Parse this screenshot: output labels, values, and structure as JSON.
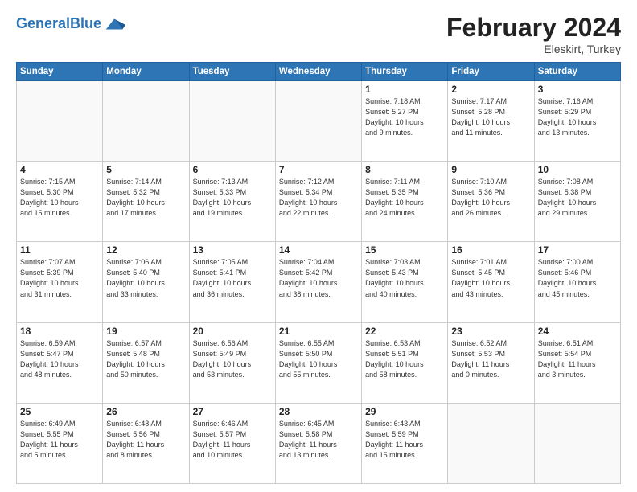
{
  "header": {
    "logo_general": "General",
    "logo_blue": "Blue",
    "month": "February 2024",
    "location": "Eleskirt, Turkey"
  },
  "weekdays": [
    "Sunday",
    "Monday",
    "Tuesday",
    "Wednesday",
    "Thursday",
    "Friday",
    "Saturday"
  ],
  "weeks": [
    [
      {
        "day": "",
        "detail": ""
      },
      {
        "day": "",
        "detail": ""
      },
      {
        "day": "",
        "detail": ""
      },
      {
        "day": "",
        "detail": ""
      },
      {
        "day": "1",
        "detail": "Sunrise: 7:18 AM\nSunset: 5:27 PM\nDaylight: 10 hours\nand 9 minutes."
      },
      {
        "day": "2",
        "detail": "Sunrise: 7:17 AM\nSunset: 5:28 PM\nDaylight: 10 hours\nand 11 minutes."
      },
      {
        "day": "3",
        "detail": "Sunrise: 7:16 AM\nSunset: 5:29 PM\nDaylight: 10 hours\nand 13 minutes."
      }
    ],
    [
      {
        "day": "4",
        "detail": "Sunrise: 7:15 AM\nSunset: 5:30 PM\nDaylight: 10 hours\nand 15 minutes."
      },
      {
        "day": "5",
        "detail": "Sunrise: 7:14 AM\nSunset: 5:32 PM\nDaylight: 10 hours\nand 17 minutes."
      },
      {
        "day": "6",
        "detail": "Sunrise: 7:13 AM\nSunset: 5:33 PM\nDaylight: 10 hours\nand 19 minutes."
      },
      {
        "day": "7",
        "detail": "Sunrise: 7:12 AM\nSunset: 5:34 PM\nDaylight: 10 hours\nand 22 minutes."
      },
      {
        "day": "8",
        "detail": "Sunrise: 7:11 AM\nSunset: 5:35 PM\nDaylight: 10 hours\nand 24 minutes."
      },
      {
        "day": "9",
        "detail": "Sunrise: 7:10 AM\nSunset: 5:36 PM\nDaylight: 10 hours\nand 26 minutes."
      },
      {
        "day": "10",
        "detail": "Sunrise: 7:08 AM\nSunset: 5:38 PM\nDaylight: 10 hours\nand 29 minutes."
      }
    ],
    [
      {
        "day": "11",
        "detail": "Sunrise: 7:07 AM\nSunset: 5:39 PM\nDaylight: 10 hours\nand 31 minutes."
      },
      {
        "day": "12",
        "detail": "Sunrise: 7:06 AM\nSunset: 5:40 PM\nDaylight: 10 hours\nand 33 minutes."
      },
      {
        "day": "13",
        "detail": "Sunrise: 7:05 AM\nSunset: 5:41 PM\nDaylight: 10 hours\nand 36 minutes."
      },
      {
        "day": "14",
        "detail": "Sunrise: 7:04 AM\nSunset: 5:42 PM\nDaylight: 10 hours\nand 38 minutes."
      },
      {
        "day": "15",
        "detail": "Sunrise: 7:03 AM\nSunset: 5:43 PM\nDaylight: 10 hours\nand 40 minutes."
      },
      {
        "day": "16",
        "detail": "Sunrise: 7:01 AM\nSunset: 5:45 PM\nDaylight: 10 hours\nand 43 minutes."
      },
      {
        "day": "17",
        "detail": "Sunrise: 7:00 AM\nSunset: 5:46 PM\nDaylight: 10 hours\nand 45 minutes."
      }
    ],
    [
      {
        "day": "18",
        "detail": "Sunrise: 6:59 AM\nSunset: 5:47 PM\nDaylight: 10 hours\nand 48 minutes."
      },
      {
        "day": "19",
        "detail": "Sunrise: 6:57 AM\nSunset: 5:48 PM\nDaylight: 10 hours\nand 50 minutes."
      },
      {
        "day": "20",
        "detail": "Sunrise: 6:56 AM\nSunset: 5:49 PM\nDaylight: 10 hours\nand 53 minutes."
      },
      {
        "day": "21",
        "detail": "Sunrise: 6:55 AM\nSunset: 5:50 PM\nDaylight: 10 hours\nand 55 minutes."
      },
      {
        "day": "22",
        "detail": "Sunrise: 6:53 AM\nSunset: 5:51 PM\nDaylight: 10 hours\nand 58 minutes."
      },
      {
        "day": "23",
        "detail": "Sunrise: 6:52 AM\nSunset: 5:53 PM\nDaylight: 11 hours\nand 0 minutes."
      },
      {
        "day": "24",
        "detail": "Sunrise: 6:51 AM\nSunset: 5:54 PM\nDaylight: 11 hours\nand 3 minutes."
      }
    ],
    [
      {
        "day": "25",
        "detail": "Sunrise: 6:49 AM\nSunset: 5:55 PM\nDaylight: 11 hours\nand 5 minutes."
      },
      {
        "day": "26",
        "detail": "Sunrise: 6:48 AM\nSunset: 5:56 PM\nDaylight: 11 hours\nand 8 minutes."
      },
      {
        "day": "27",
        "detail": "Sunrise: 6:46 AM\nSunset: 5:57 PM\nDaylight: 11 hours\nand 10 minutes."
      },
      {
        "day": "28",
        "detail": "Sunrise: 6:45 AM\nSunset: 5:58 PM\nDaylight: 11 hours\nand 13 minutes."
      },
      {
        "day": "29",
        "detail": "Sunrise: 6:43 AM\nSunset: 5:59 PM\nDaylight: 11 hours\nand 15 minutes."
      },
      {
        "day": "",
        "detail": ""
      },
      {
        "day": "",
        "detail": ""
      }
    ]
  ]
}
